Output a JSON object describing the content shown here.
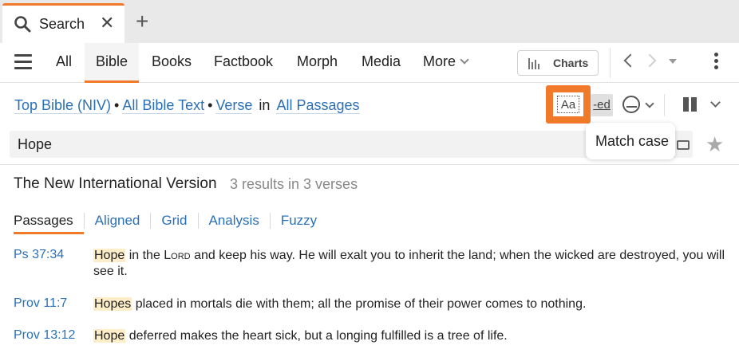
{
  "tab": {
    "label": "Search"
  },
  "nav": {
    "items": [
      "All",
      "Bible",
      "Books",
      "Factbook",
      "Morph",
      "Media",
      "More"
    ],
    "active": "Bible",
    "charts_label": "Charts"
  },
  "query": {
    "bible": "Top Bible (NIV)",
    "scope": "All Bible Text",
    "unit": "Verse",
    "in": "in",
    "range": "All Passages",
    "match_case_label": "Aa",
    "ed_label": "-ed"
  },
  "search": {
    "value": "Hope"
  },
  "tooltip": {
    "text": "Match case"
  },
  "results": {
    "title": "The New International Version",
    "count": "3 results in 3 verses",
    "tabs": [
      "Passages",
      "Aligned",
      "Grid",
      "Analysis",
      "Fuzzy"
    ],
    "rows": [
      {
        "ref": "Ps 37:34",
        "hit": "Hope",
        "pre": " in the ",
        "lord": "Lord",
        "rest": " and keep his way. He will exalt you to inherit the land; when the wicked are destroyed, you will see it."
      },
      {
        "ref": "Prov 11:7",
        "hit": "Hopes",
        "rest": " placed in mortals die with them; all the promise of their power comes to nothing."
      },
      {
        "ref": "Prov 13:12",
        "hit": "Hope",
        "rest": " deferred makes the heart sick, but a longing fulfilled is a tree of life."
      }
    ]
  },
  "colors": {
    "accent": "#f07a2a",
    "link": "#2a70b8",
    "highlight": "#fdedc8"
  }
}
